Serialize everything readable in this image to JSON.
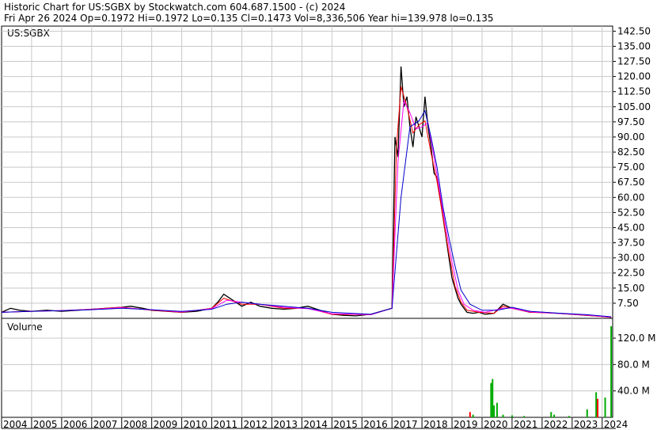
{
  "header": {
    "line1": "Historic Chart for US:SGBX by Stockwatch.com 604.687.1500 - (c) 2024",
    "line2": "Fri Apr 26 2024   Op=0.1972   Hi=0.1972   Lo=0.135   Cl=0.1473   Vol=8,336,506   Year hi=139.978   lo=0.135"
  },
  "colors": {
    "price": "#000000",
    "ma_short": "#ff0000",
    "ma_mid": "#ff00ff",
    "ma_long": "#0000cc",
    "volume": "#00aa00",
    "volume_up": "#ff0000",
    "grid": "#c8c8c8"
  },
  "chart_data": [
    {
      "type": "line",
      "symbol": "US:SGBX",
      "ylim": [
        0,
        145
      ],
      "y_ticks": [
        "142.50",
        "135.00",
        "127.50",
        "120.00",
        "112.50",
        "105.00",
        "97.50",
        "90.00",
        "82.50",
        "75.00",
        "67.50",
        "60.00",
        "52.50",
        "45.00",
        "37.50",
        "30.00",
        "22.50",
        "15.00",
        "7.50"
      ],
      "x_ticks": [
        "2004",
        "2005",
        "2006",
        "2007",
        "2008",
        "2009",
        "2010",
        "2011",
        "2012",
        "2013",
        "2014",
        "2015",
        "2016",
        "2017",
        "2018",
        "2019",
        "2020",
        "2021",
        "2022",
        "2023",
        "2024"
      ],
      "xlim": [
        2004.0,
        2024.35
      ],
      "series": [
        {
          "color_key": "price",
          "x": [
            2004.0,
            2004.3,
            2004.6,
            2005.0,
            2005.5,
            2006.0,
            2006.5,
            2007.0,
            2007.5,
            2008.0,
            2008.3,
            2008.7,
            2009.0,
            2009.5,
            2010.0,
            2010.5,
            2011.0,
            2011.2,
            2011.4,
            2011.6,
            2011.8,
            2012.0,
            2012.3,
            2012.6,
            2013.0,
            2013.4,
            2013.8,
            2014.2,
            2014.6,
            2015.0,
            2015.4,
            2015.8,
            2016.3,
            2017.0,
            2017.1,
            2017.2,
            2017.3,
            2017.4,
            2017.5,
            2017.6,
            2017.7,
            2017.8,
            2017.9,
            2018.0,
            2018.1,
            2018.2,
            2018.3,
            2018.4,
            2018.5,
            2018.6,
            2018.7,
            2018.8,
            2018.9,
            2019.0,
            2019.1,
            2019.2,
            2019.3,
            2019.4,
            2019.5,
            2019.7,
            2019.9,
            2020.1,
            2020.4,
            2020.7,
            2021.0,
            2021.3,
            2021.6,
            2022.0,
            2022.5,
            2023.0,
            2023.5,
            2024.0,
            2024.3
          ],
          "values": [
            3,
            5,
            4,
            3.5,
            4,
            3.5,
            4,
            4.5,
            5,
            5.5,
            6,
            5,
            4,
            3.5,
            3,
            3.5,
            5,
            8,
            12,
            10,
            8,
            6,
            8,
            6,
            5,
            4.5,
            5,
            6,
            4,
            2,
            1.5,
            1.2,
            2,
            5,
            90,
            80,
            125,
            105,
            110,
            95,
            85,
            100,
            95,
            90,
            110,
            95,
            85,
            72,
            70,
            60,
            50,
            40,
            30,
            20,
            15,
            10,
            7,
            5,
            3,
            2.5,
            3,
            2,
            2.5,
            7,
            5,
            4,
            3,
            3,
            2.5,
            2,
            1.5,
            1,
            0.5
          ]
        },
        {
          "color_key": "ma_short",
          "x": [
            2004.0,
            2005.0,
            2006.0,
            2007.0,
            2008.0,
            2009.0,
            2010.0,
            2011.0,
            2011.4,
            2012.0,
            2012.6,
            2013.4,
            2014.2,
            2015.0,
            2016.3,
            2017.0,
            2017.15,
            2017.3,
            2017.5,
            2017.7,
            2017.9,
            2018.1,
            2018.3,
            2018.5,
            2018.7,
            2018.9,
            2019.1,
            2019.3,
            2019.5,
            2019.9,
            2020.4,
            2020.7,
            2021.0,
            2021.6,
            2022.5,
            2023.5,
            2024.3
          ],
          "values": [
            3,
            3.5,
            3.8,
            4.5,
            5.5,
            4,
            3,
            5,
            10,
            7,
            7,
            5,
            5,
            2,
            1.8,
            5,
            85,
            115,
            105,
            92,
            96,
            98,
            82,
            68,
            50,
            32,
            16,
            8,
            4,
            3,
            2.5,
            6,
            5,
            3,
            2.5,
            1.5,
            0.5
          ]
        },
        {
          "color_key": "ma_mid",
          "x": [
            2004.0,
            2005.0,
            2006.0,
            2007.0,
            2008.0,
            2009.0,
            2010.0,
            2011.0,
            2011.5,
            2012.0,
            2012.6,
            2013.4,
            2014.2,
            2015.0,
            2016.3,
            2017.0,
            2017.2,
            2017.4,
            2017.6,
            2017.8,
            2018.0,
            2018.2,
            2018.4,
            2018.6,
            2018.8,
            2019.0,
            2019.2,
            2019.4,
            2019.7,
            2020.1,
            2020.7,
            2021.0,
            2021.6,
            2022.5,
            2023.5,
            2024.3
          ],
          "values": [
            3,
            3.5,
            3.8,
            4.4,
            5.3,
            4.2,
            3.2,
            4.8,
            9,
            8,
            7,
            5.5,
            4.8,
            2.3,
            1.8,
            5,
            78,
            108,
            102,
            94,
            95,
            97,
            80,
            62,
            44,
            28,
            14,
            7,
            4,
            3,
            5,
            5,
            3.2,
            2.5,
            1.6,
            0.6
          ]
        },
        {
          "color_key": "ma_long",
          "x": [
            2004.0,
            2005.0,
            2006.0,
            2007.0,
            2008.0,
            2009.0,
            2010.0,
            2011.0,
            2011.5,
            2012.0,
            2012.6,
            2013.4,
            2014.2,
            2015.0,
            2016.3,
            2017.0,
            2017.3,
            2017.6,
            2017.9,
            2018.1,
            2018.3,
            2018.5,
            2018.7,
            2018.9,
            2019.1,
            2019.3,
            2019.6,
            2020.0,
            2020.5,
            2021.0,
            2021.6,
            2022.5,
            2023.5,
            2024.3
          ],
          "values": [
            3,
            3.5,
            3.8,
            4.3,
            5,
            4.3,
            3.4,
            4.5,
            7,
            8,
            7,
            6,
            5,
            3,
            2,
            5,
            60,
            95,
            98,
            103,
            90,
            75,
            55,
            40,
            26,
            14,
            7,
            4,
            4,
            5.5,
            3.5,
            2.6,
            1.8,
            0.8
          ]
        }
      ]
    },
    {
      "type": "bar",
      "title": "Volume",
      "ylim": [
        0,
        150
      ],
      "y_ticks": [
        "120.0 M",
        "80.0 M",
        "40.0 M"
      ],
      "bars": [
        {
          "x": 2019.6,
          "value": 8,
          "color_key": "volume_up"
        },
        {
          "x": 2019.7,
          "value": 4,
          "color_key": "volume"
        },
        {
          "x": 2020.3,
          "value": 52,
          "color_key": "volume"
        },
        {
          "x": 2020.35,
          "value": 58,
          "color_key": "volume"
        },
        {
          "x": 2020.4,
          "value": 18,
          "color_key": "volume"
        },
        {
          "x": 2020.5,
          "value": 22,
          "color_key": "volume"
        },
        {
          "x": 2020.7,
          "value": 4,
          "color_key": "volume"
        },
        {
          "x": 2021.0,
          "value": 3,
          "color_key": "volume"
        },
        {
          "x": 2021.4,
          "value": 2,
          "color_key": "volume"
        },
        {
          "x": 2022.3,
          "value": 8,
          "color_key": "volume"
        },
        {
          "x": 2022.4,
          "value": 4,
          "color_key": "volume"
        },
        {
          "x": 2022.9,
          "value": 2,
          "color_key": "volume"
        },
        {
          "x": 2023.5,
          "value": 12,
          "color_key": "volume"
        },
        {
          "x": 2023.8,
          "value": 38,
          "color_key": "volume"
        },
        {
          "x": 2023.85,
          "value": 28,
          "color_key": "volume_up"
        },
        {
          "x": 2024.1,
          "value": 30,
          "color_key": "volume"
        },
        {
          "x": 2024.3,
          "value": 138,
          "color_key": "volume"
        }
      ]
    }
  ]
}
